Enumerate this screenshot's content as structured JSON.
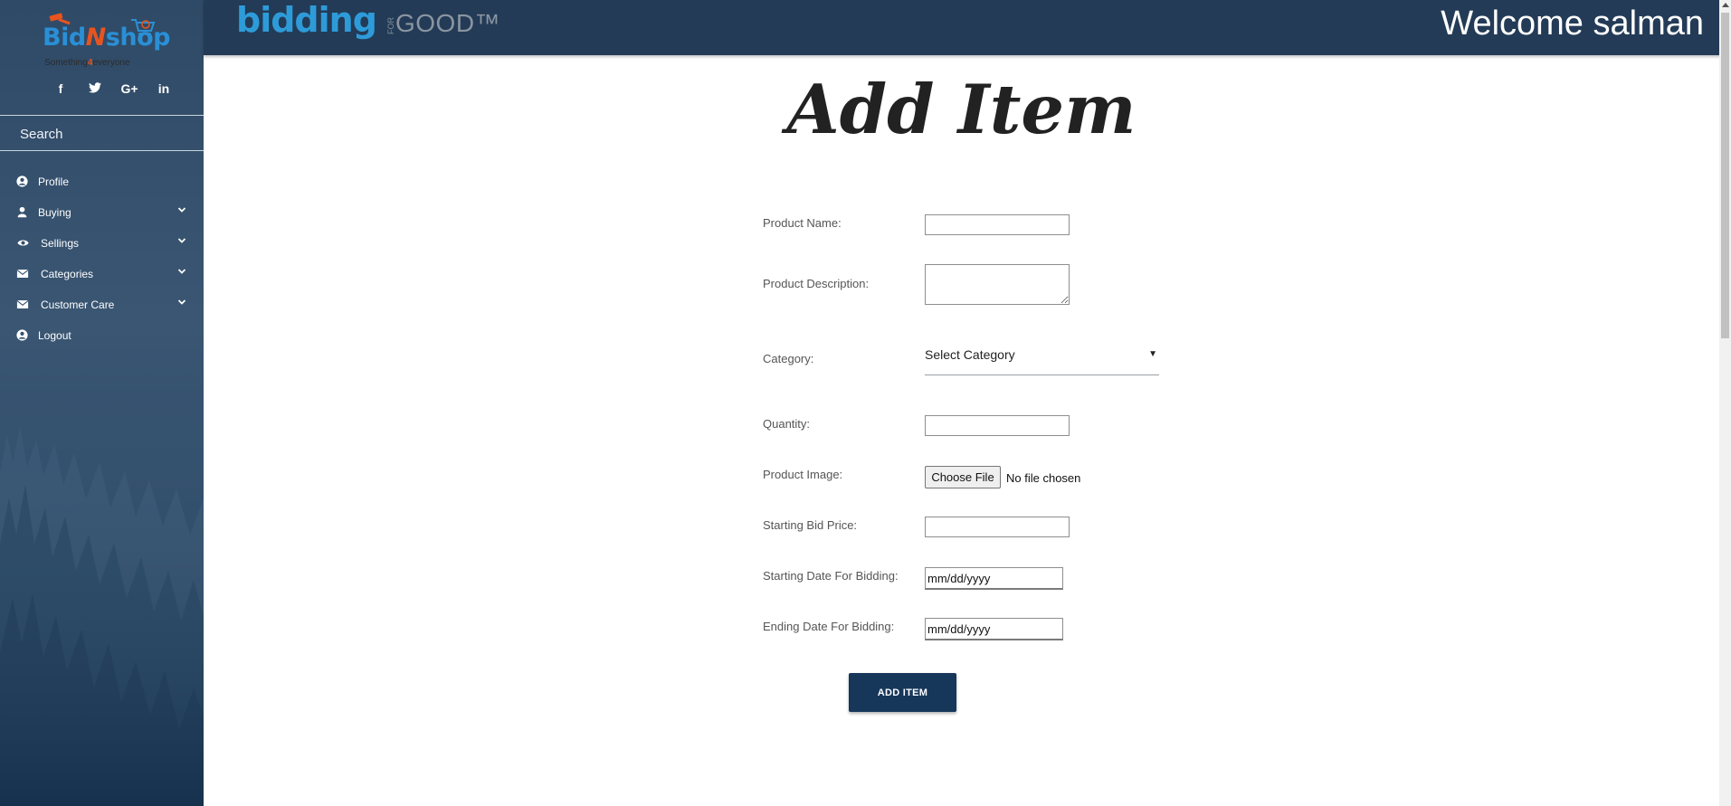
{
  "sidebar": {
    "logo": {
      "brand_pre": "Bid",
      "brand_n": "N",
      "brand_post": "shop",
      "tag_pre": "Something",
      "tag_four": "4",
      "tag_post": "everyone"
    },
    "social": [
      {
        "icon": "facebook-icon",
        "glyph": "f"
      },
      {
        "icon": "twitter-icon",
        "glyph": "🐦"
      },
      {
        "icon": "google-plus-icon",
        "glyph": "G+"
      },
      {
        "icon": "linkedin-icon",
        "glyph": "in"
      }
    ],
    "search_placeholder": "Search",
    "nav": [
      {
        "label": "Profile",
        "icon": "user-circle-icon",
        "has_dropdown": false
      },
      {
        "label": "Buying",
        "icon": "user-icon",
        "has_dropdown": true
      },
      {
        "label": "Sellings",
        "icon": "eye-icon",
        "has_dropdown": true
      },
      {
        "label": "Categories",
        "icon": "envelope-icon",
        "has_dropdown": true
      },
      {
        "label": "Customer Care",
        "icon": "envelope-icon",
        "has_dropdown": true
      },
      {
        "label": "Logout",
        "icon": "user-circle-icon",
        "has_dropdown": false
      }
    ]
  },
  "header": {
    "logo_bidding": "bidding",
    "logo_for": "FOR",
    "logo_good": "GOOD™",
    "welcome": "Welcome salman"
  },
  "form": {
    "title": "Add Item",
    "product_name_label": "Product Name:",
    "product_description_label": "Product Description:",
    "category_label": "Category:",
    "category_value": "Select Category",
    "quantity_label": "Quantity:",
    "product_image_label": "Product Image:",
    "choose_file": "Choose File",
    "no_file": "No file chosen",
    "starting_bid_label": "Starting Bid Price:",
    "start_date_label": "Starting Date For Bidding:",
    "start_date_value": "mm/dd/yyyy",
    "end_date_label": "Ending Date For Bidding:",
    "end_date_value": "mm/dd/yyyy",
    "submit_label": "ADD ITEM"
  },
  "colors": {
    "sidebar_bg": "#2f4a66",
    "header_bg": "#233b56",
    "button_bg": "#16365a",
    "brand_blue": "#2a8fd6",
    "brand_orange": "#e8541f"
  }
}
